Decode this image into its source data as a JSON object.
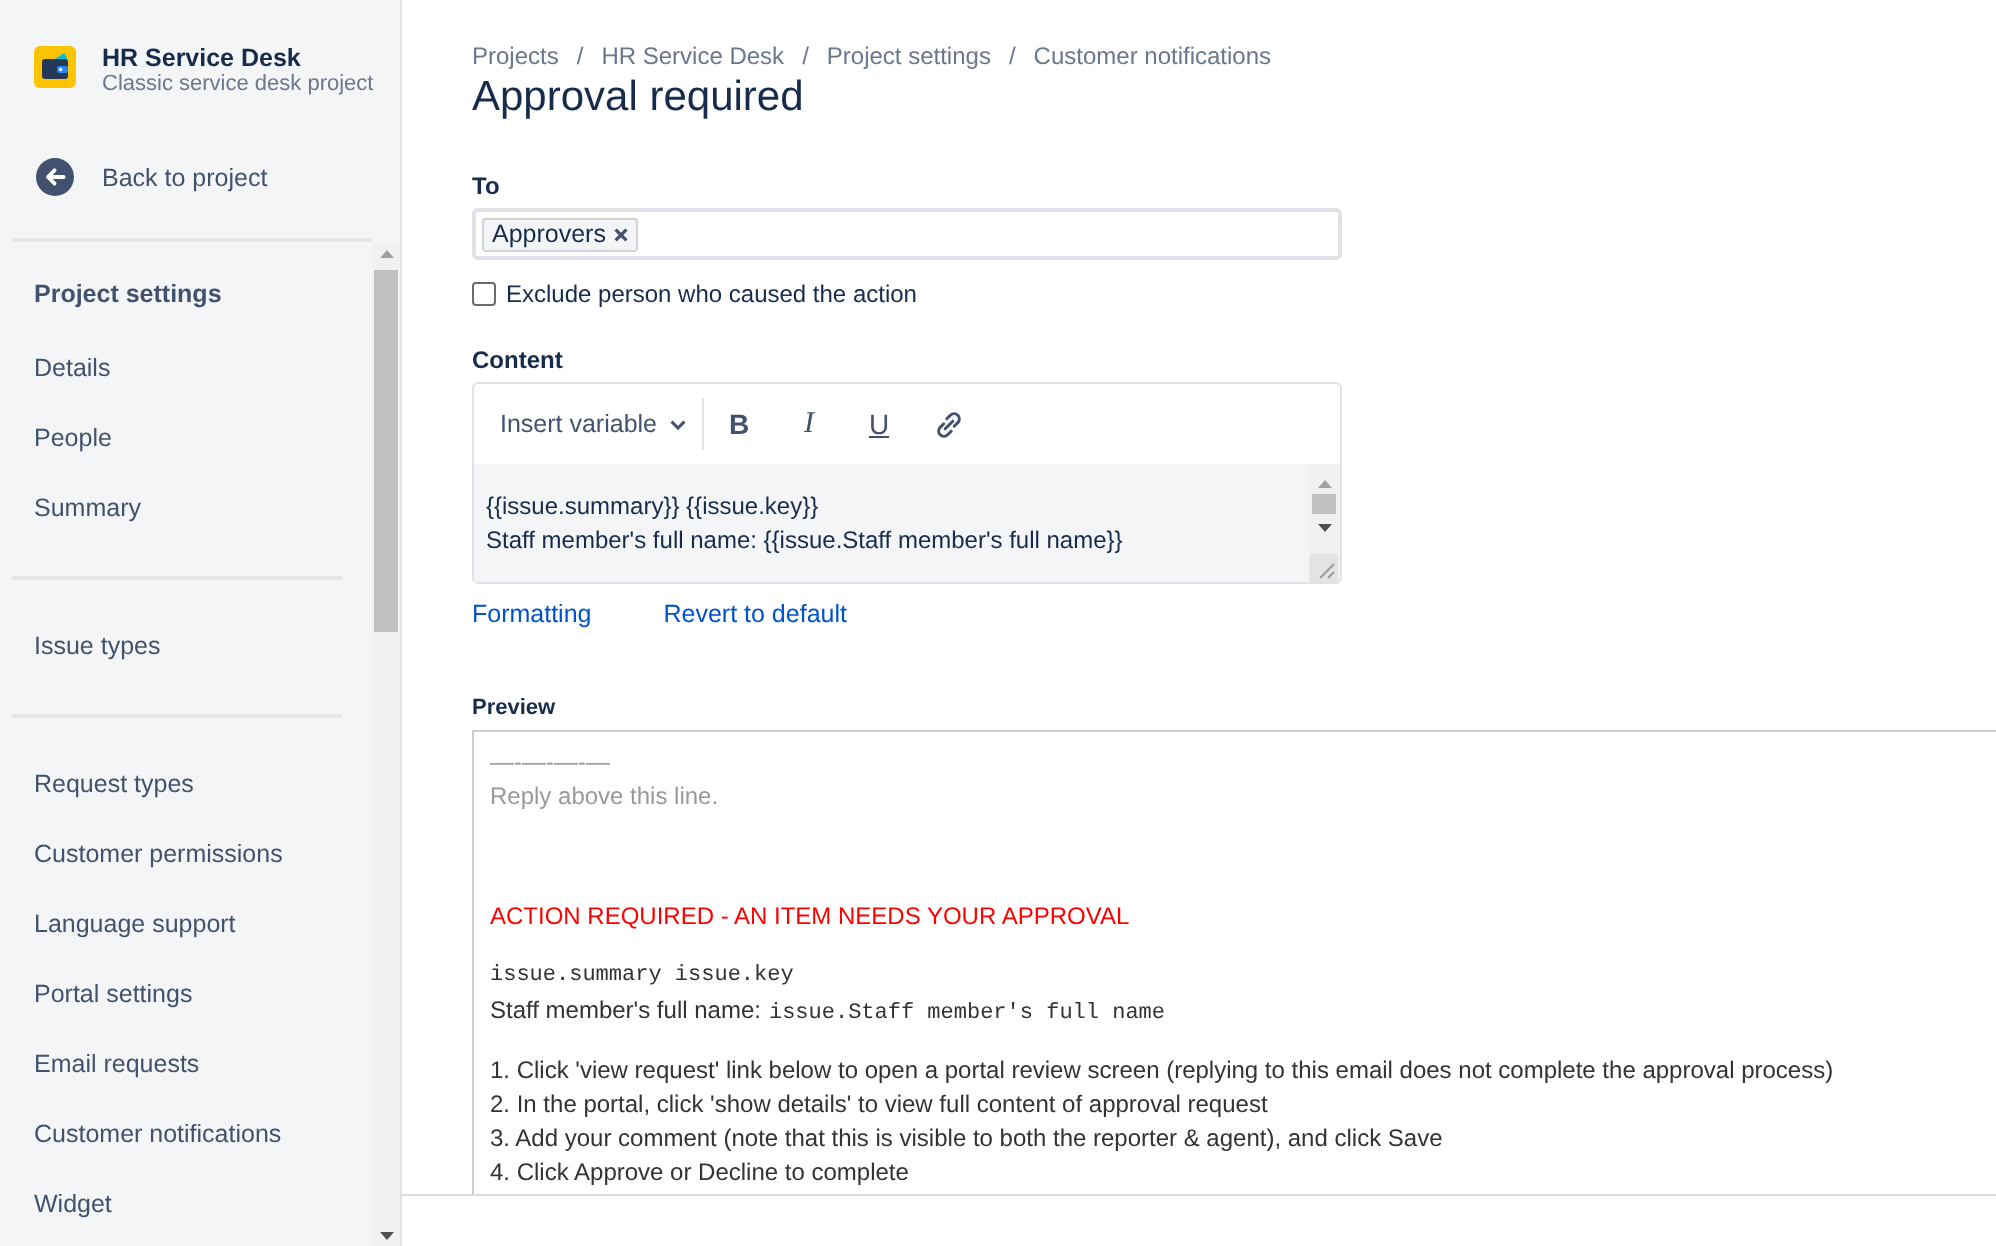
{
  "sidebar": {
    "project": {
      "name": "HR Service Desk",
      "type": "Classic service desk project"
    },
    "back_link": "Back to project",
    "sections": [
      {
        "heading": "Project settings",
        "items": [
          {
            "label": "Details",
            "selected": false
          },
          {
            "label": "People",
            "selected": false
          },
          {
            "label": "Summary",
            "selected": false
          }
        ]
      },
      {
        "items": [
          {
            "label": "Issue types",
            "selected": false
          }
        ]
      },
      {
        "items": [
          {
            "label": "Request types",
            "selected": false
          },
          {
            "label": "Customer permissions",
            "selected": false
          },
          {
            "label": "Language support",
            "selected": false
          },
          {
            "label": "Portal settings",
            "selected": false
          },
          {
            "label": "Email requests",
            "selected": false
          },
          {
            "label": "Customer notifications",
            "selected": false
          },
          {
            "label": "Widget",
            "selected": false
          }
        ]
      }
    ]
  },
  "breadcrumbs": [
    {
      "label": "Projects",
      "separator": "/"
    },
    {
      "label": "HR Service Desk",
      "separator": "/"
    },
    {
      "label": "Project settings",
      "separator": "/"
    },
    {
      "label": "Customer notifications"
    }
  ],
  "title": "Approval required",
  "recipients": {
    "label": "To",
    "tags": [
      "Approvers"
    ]
  },
  "exclude_option": {
    "label": "Exclude person who caused the action",
    "checked": false
  },
  "content": {
    "label": "Content",
    "toolbar": [
      {
        "kind": "dropdown",
        "label": "Insert variable"
      },
      {
        "kind": "bold",
        "label": "B"
      },
      {
        "kind": "italic",
        "label": "I"
      },
      {
        "kind": "underline",
        "label": "U"
      },
      {
        "kind": "link"
      }
    ],
    "lines": [
      "{{issue.summary}} {{issue.key}}",
      "Staff member's full name: {{issue.Staff member's full name}}"
    ]
  },
  "links": [
    "Formatting",
    "Revert to default"
  ],
  "preview": {
    "label": "Preview",
    "blocks": [
      {
        "kind": "marker",
        "text": "—-—-—-—"
      },
      {
        "kind": "muted",
        "text": "Reply above this line."
      },
      {
        "kind": "alert",
        "text": "ACTION REQUIRED - AN ITEM NEEDS YOUR APPROVAL"
      },
      {
        "kind": "code",
        "text": "issue.summary issue.key"
      },
      {
        "kind": "field",
        "label": "Staff member's full name:",
        "code": "issue.Staff member's full name"
      },
      {
        "kind": "step",
        "text": "1. Click 'view request' link below to open a portal review screen (replying to this email does not complete the approval process)"
      },
      {
        "kind": "step",
        "text": "2. In the portal, click 'show details' to view full content of approval request"
      },
      {
        "kind": "step",
        "text": "3. Add your comment (note that this is visible to both the reporter & agent), and click Save"
      },
      {
        "kind": "step",
        "text": "4. Click Approve or Decline to complete"
      }
    ]
  }
}
